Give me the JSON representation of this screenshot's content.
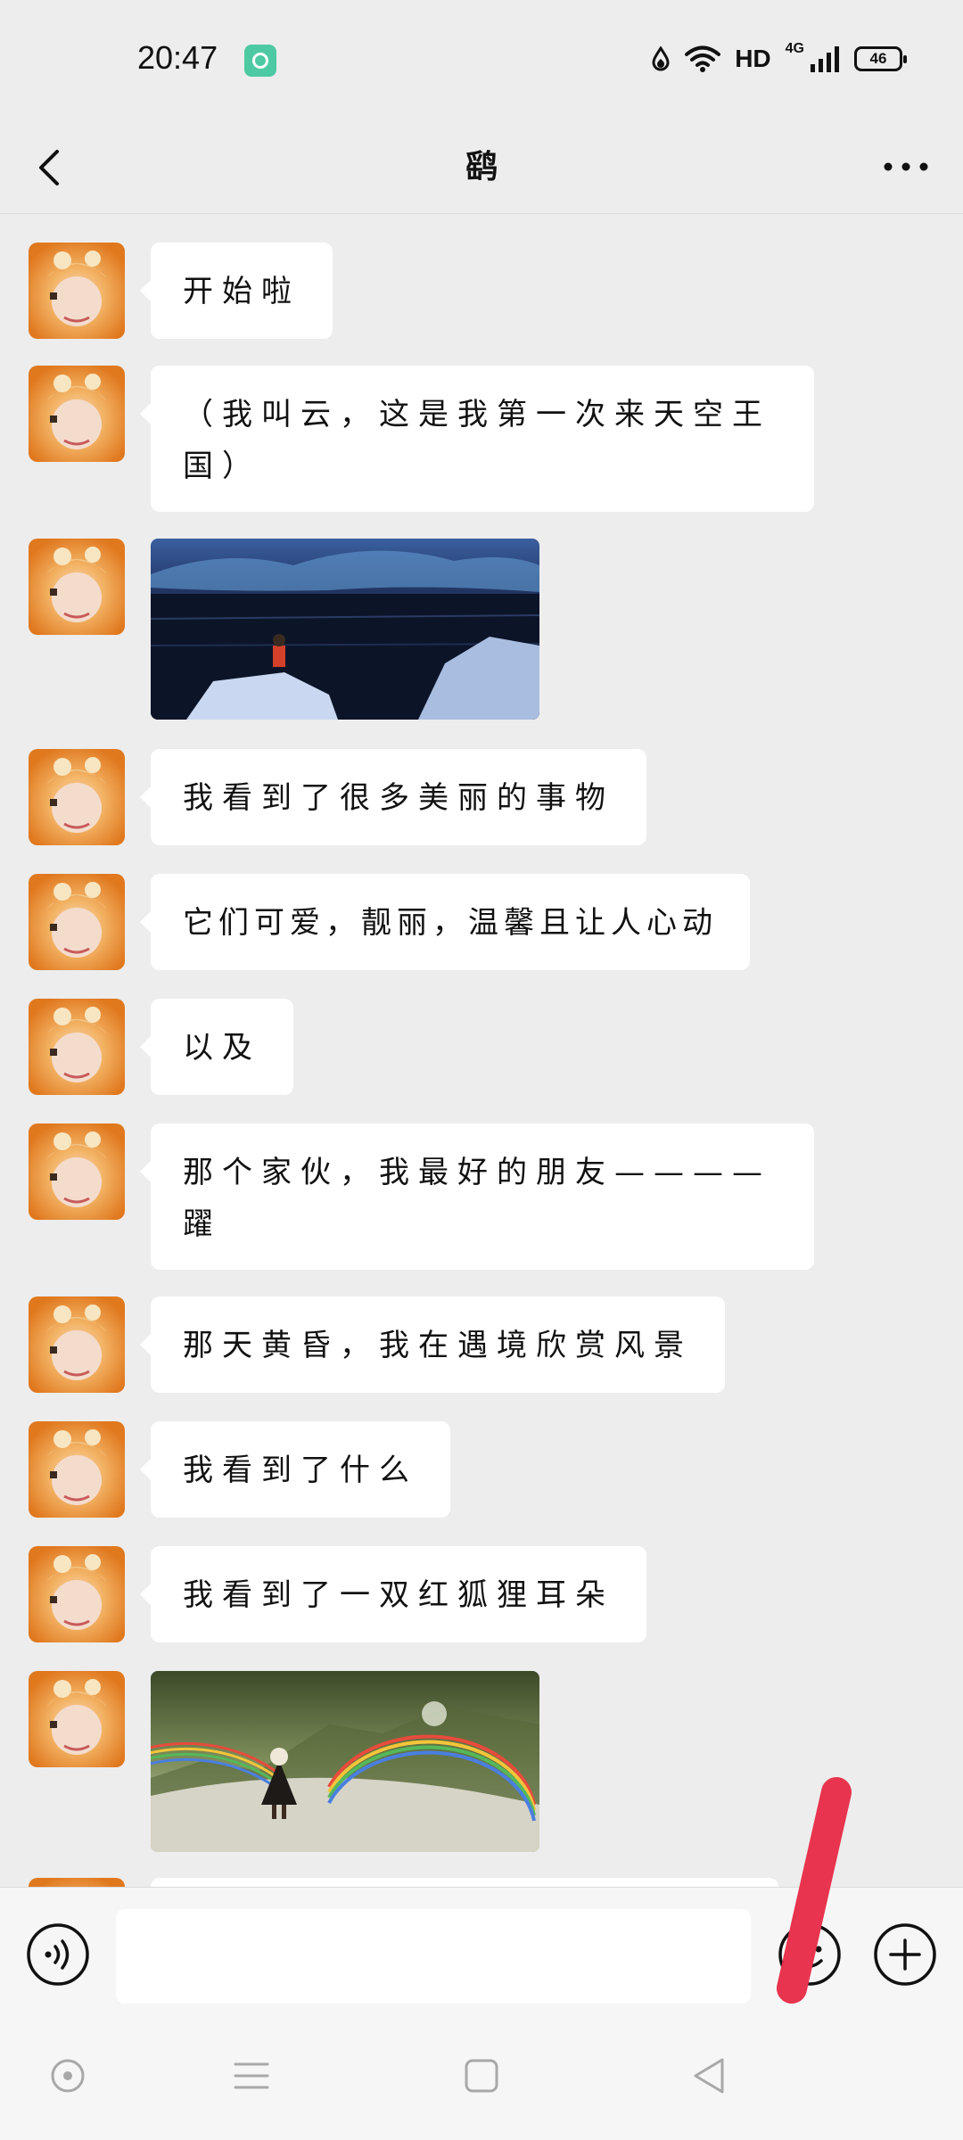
{
  "status_bar": {
    "time": "20:47",
    "hd": "HD",
    "network": "4G",
    "battery": "46",
    "icons": [
      "app-notification-icon",
      "data-saver-drop-icon",
      "wifi-icon",
      "signal-icon",
      "battery-icon"
    ]
  },
  "header": {
    "title": "鹞",
    "back_icon": "chevron-left-icon",
    "more_icon": "more-dots-icon"
  },
  "messages": [
    {
      "type": "text",
      "text": "开始啦"
    },
    {
      "type": "text",
      "text": "（我叫云，这是我第一次来天空王国）"
    },
    {
      "type": "image",
      "description_icon": "night-sea-photo"
    },
    {
      "type": "text",
      "text": "我看到了很多美丽的事物"
    },
    {
      "type": "text",
      "text": "它们可爱，靓丽，温馨且让人心动"
    },
    {
      "type": "text",
      "text": "以及"
    },
    {
      "type": "text",
      "text": "那个家伙，我最好的朋友————躍"
    },
    {
      "type": "text",
      "text": "那天黄昏，我在遇境欣赏风景"
    },
    {
      "type": "text",
      "text": "我看到了什么"
    },
    {
      "type": "text",
      "text": "我看到了一双红狐狸耳朵"
    },
    {
      "type": "image",
      "description_icon": "rainbow-valley-photo"
    }
  ],
  "input_bar": {
    "placeholder": "",
    "icons": [
      "voice-icon",
      "emoji-icon",
      "plus-icon"
    ]
  },
  "nav_bar": {
    "icons": [
      "assistant-circle-icon",
      "menu-lines-icon",
      "home-square-icon",
      "back-triangle-icon"
    ]
  },
  "colors": {
    "background": "#ededed",
    "bubble": "#ffffff",
    "annotation_stroke": "#e8344e",
    "notification": "#4dc9a3"
  }
}
